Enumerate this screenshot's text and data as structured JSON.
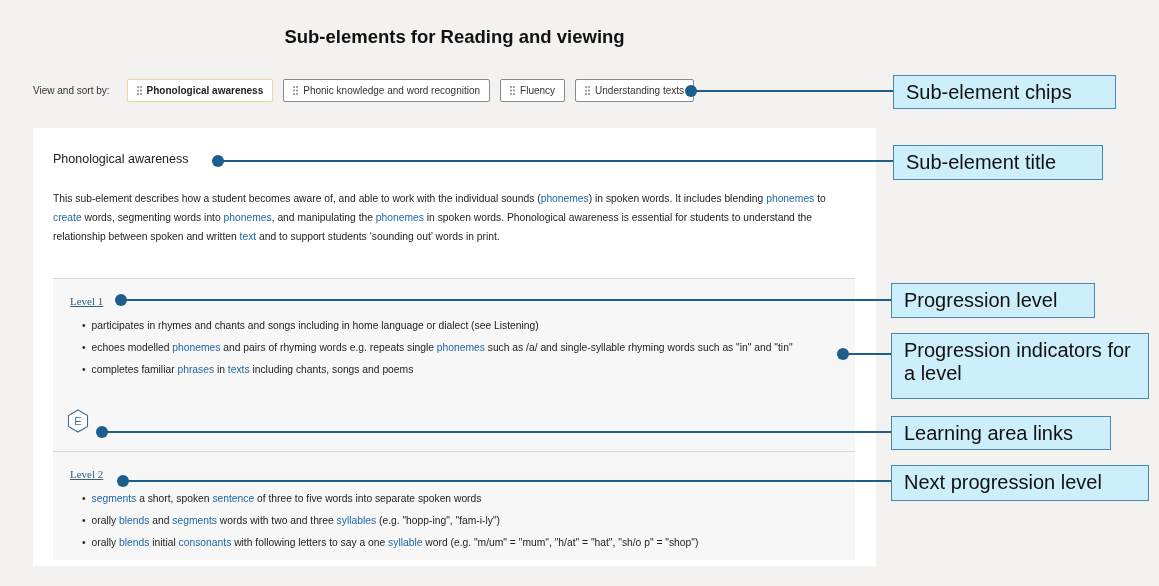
{
  "title": "Sub-elements for Reading and viewing",
  "sort": {
    "label": "View and sort by:",
    "chips": [
      {
        "label": "Phonological awareness",
        "selected": true
      },
      {
        "label": "Phonic knowledge and word recognition",
        "selected": false
      },
      {
        "label": "Fluency",
        "selected": false
      },
      {
        "label": "Understanding texts",
        "selected": false
      }
    ]
  },
  "sub_element": {
    "title": "Phonological awareness",
    "description": [
      {
        "text": "This sub-element describes how a student becomes aware of, and able to work with the individual sounds (",
        "link": false
      },
      {
        "text": "phonemes",
        "link": true
      },
      {
        "text": ") in spoken words. It includes blending ",
        "link": false
      },
      {
        "text": "phonemes",
        "link": true
      },
      {
        "text": " to ",
        "link": false
      },
      {
        "text": "create",
        "link": true
      },
      {
        "text": " words, segmenting words into ",
        "link": false
      },
      {
        "text": "phonemes",
        "link": true
      },
      {
        "text": ", and manipulating the ",
        "link": false
      },
      {
        "text": "phonemes",
        "link": true
      },
      {
        "text": " in spoken words. Phonological awareness is essential for students to understand the relationship between spoken and written ",
        "link": false
      },
      {
        "text": "text",
        "link": true
      },
      {
        "text": " and to support students ‘sounding out’ words in print.",
        "link": false
      }
    ]
  },
  "levels": [
    {
      "label": "Level 1",
      "indicators": [
        {
          "bullet": "•",
          "text": [
            {
              "text": "participates in rhymes and chants and songs including in home language or dialect (see Listening)",
              "link": false
            }
          ]
        },
        {
          "bullet": "•",
          "text": [
            {
              "text": "echoes modelled ",
              "link": false
            },
            {
              "text": "phonemes",
              "link": true
            },
            {
              "text": " and pairs of rhyming words e.g. repeats single ",
              "link": false
            },
            {
              "text": "phonemes",
              "link": true
            },
            {
              "text": " such as /a/ and single-syllable rhyming words such as \"in\" and \"tin\"",
              "link": false
            }
          ]
        },
        {
          "bullet": "•",
          "text": [
            {
              "text": "completes familiar ",
              "link": false
            },
            {
              "text": "phrases",
              "link": true
            },
            {
              "text": " in ",
              "link": false
            },
            {
              "text": "texts",
              "link": true
            },
            {
              "text": " including chants, songs and poems",
              "link": false
            }
          ]
        }
      ],
      "learning_links": [
        "E"
      ]
    },
    {
      "label": "Level 2",
      "indicators": [
        {
          "bullet": "•",
          "text": [
            {
              "text": "segments",
              "link": true
            },
            {
              "text": " a short, spoken ",
              "link": false
            },
            {
              "text": "sentence",
              "link": true
            },
            {
              "text": " of three to five words into separate spoken words",
              "link": false
            }
          ]
        },
        {
          "bullet": "•",
          "text": [
            {
              "text": "orally ",
              "link": false
            },
            {
              "text": "blends",
              "link": true
            },
            {
              "text": " and ",
              "link": false
            },
            {
              "text": "segments",
              "link": true
            },
            {
              "text": " words with two and three ",
              "link": false
            },
            {
              "text": "syllables",
              "link": true
            },
            {
              "text": " (e.g. \"hopp-ing\", \"fam-i-ly\")",
              "link": false
            }
          ]
        },
        {
          "bullet": "•",
          "text": [
            {
              "text": "orally ",
              "link": false
            },
            {
              "text": "blends",
              "link": true
            },
            {
              "text": " initial ",
              "link": false
            },
            {
              "text": "consonants",
              "link": true
            },
            {
              "text": " with following letters to say a one ",
              "link": false
            },
            {
              "text": "syllable",
              "link": true
            },
            {
              "text": " word (e.g. \"m/um\" = \"mum\", \"h/at\" = \"hat\", \"sh/o p\" = \"shop\")",
              "link": false
            }
          ]
        }
      ]
    }
  ],
  "callouts": [
    {
      "text": "Sub-element chips"
    },
    {
      "text": "Sub-element title"
    },
    {
      "text": "Progression level"
    },
    {
      "text": "Progression indicators for a level"
    },
    {
      "text": "Learning area links"
    },
    {
      "text": "Next progression level"
    }
  ]
}
